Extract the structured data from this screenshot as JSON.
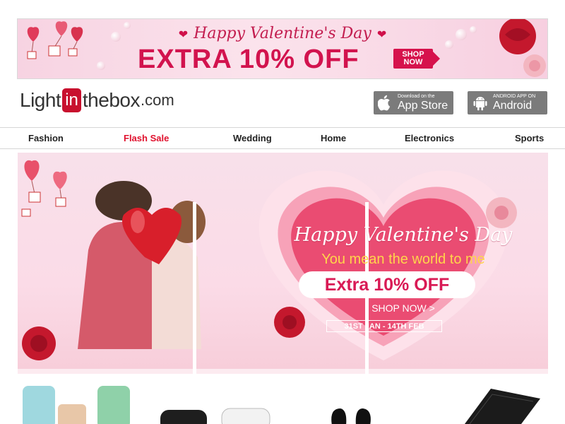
{
  "top_banner": {
    "heading": "Happy Valentine's Day",
    "offer": "EXTRA 10% OFF",
    "shop_now": "SHOP NOW"
  },
  "header": {
    "logo_part1": "Light",
    "logo_in": "in",
    "logo_part2": "thebox",
    "logo_part3": ".com",
    "appstore_small": "Download on the",
    "appstore_big": "App Store",
    "android_small": "ANDROID APP ON",
    "android_big": "Android"
  },
  "nav": {
    "items": [
      {
        "label": "Fashion"
      },
      {
        "label": "Flash Sale"
      },
      {
        "label": "Wedding"
      },
      {
        "label": "Home"
      },
      {
        "label": "Electronics"
      },
      {
        "label": "Sports"
      }
    ]
  },
  "hero": {
    "title": "Happy Valentine's Day",
    "subtitle": "You mean the world to me",
    "offer": "Extra 10% OFF",
    "cta": "SHOP NOW >",
    "dates": "31ST JAN - 14TH FEB"
  },
  "colors": {
    "accent": "#d2134e",
    "nav_hot": "#e0102d",
    "store_button": "#7b7b7b"
  }
}
